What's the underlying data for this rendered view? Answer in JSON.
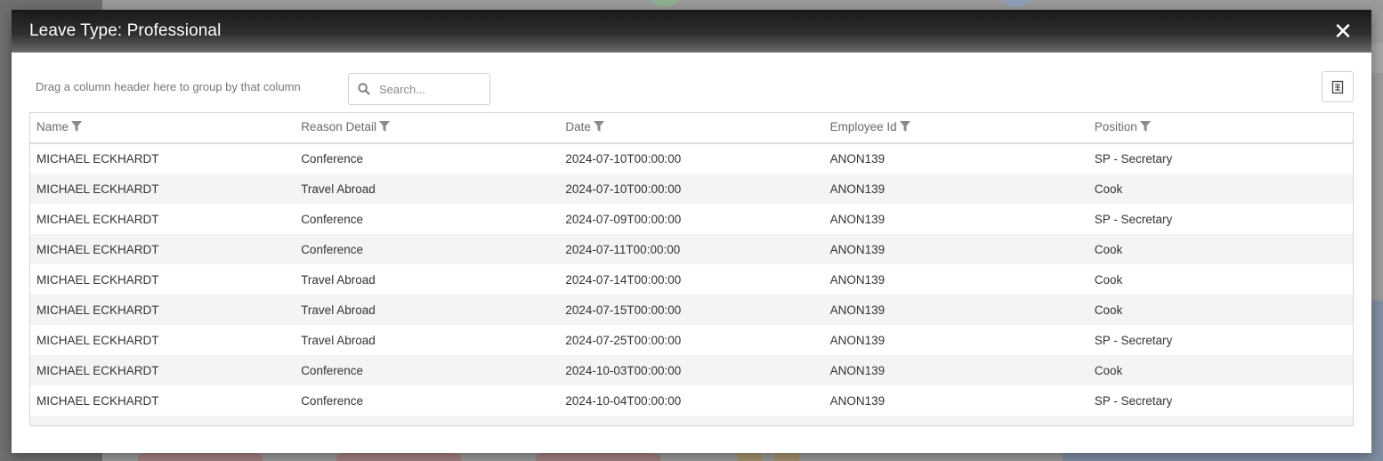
{
  "modal": {
    "title": "Leave Type: Professional",
    "close_label": "✕"
  },
  "toolbar": {
    "group_hint": "Drag a column header here to group by that column",
    "search_placeholder": "Search..."
  },
  "grid": {
    "columns": [
      "Name",
      "Reason Detail",
      "Date",
      "Employee Id",
      "Position"
    ],
    "rows": [
      [
        "MICHAEL ECKHARDT",
        "Conference",
        "2024-07-10T00:00:00",
        "ANON139",
        "SP - Secretary"
      ],
      [
        "MICHAEL ECKHARDT",
        "Travel Abroad",
        "2024-07-10T00:00:00",
        "ANON139",
        "Cook"
      ],
      [
        "MICHAEL ECKHARDT",
        "Conference",
        "2024-07-09T00:00:00",
        "ANON139",
        "SP - Secretary"
      ],
      [
        "MICHAEL ECKHARDT",
        "Conference",
        "2024-07-11T00:00:00",
        "ANON139",
        "Cook"
      ],
      [
        "MICHAEL ECKHARDT",
        "Travel Abroad",
        "2024-07-14T00:00:00",
        "ANON139",
        "Cook"
      ],
      [
        "MICHAEL ECKHARDT",
        "Travel Abroad",
        "2024-07-15T00:00:00",
        "ANON139",
        "Cook"
      ],
      [
        "MICHAEL ECKHARDT",
        "Travel Abroad",
        "2024-07-25T00:00:00",
        "ANON139",
        "SP - Secretary"
      ],
      [
        "MICHAEL ECKHARDT",
        "Conference",
        "2024-10-03T00:00:00",
        "ANON139",
        "Cook"
      ],
      [
        "MICHAEL ECKHARDT",
        "Conference",
        "2024-10-04T00:00:00",
        "ANON139",
        "SP - Secretary"
      ]
    ]
  },
  "icons": {
    "close": "close-icon",
    "search": "search-icon",
    "export": "export-icon",
    "filter": "filter-icon"
  },
  "colors": {
    "header_dark": "#1a1a1a",
    "row_alt": "#f4f4f4",
    "text": "#333333"
  }
}
